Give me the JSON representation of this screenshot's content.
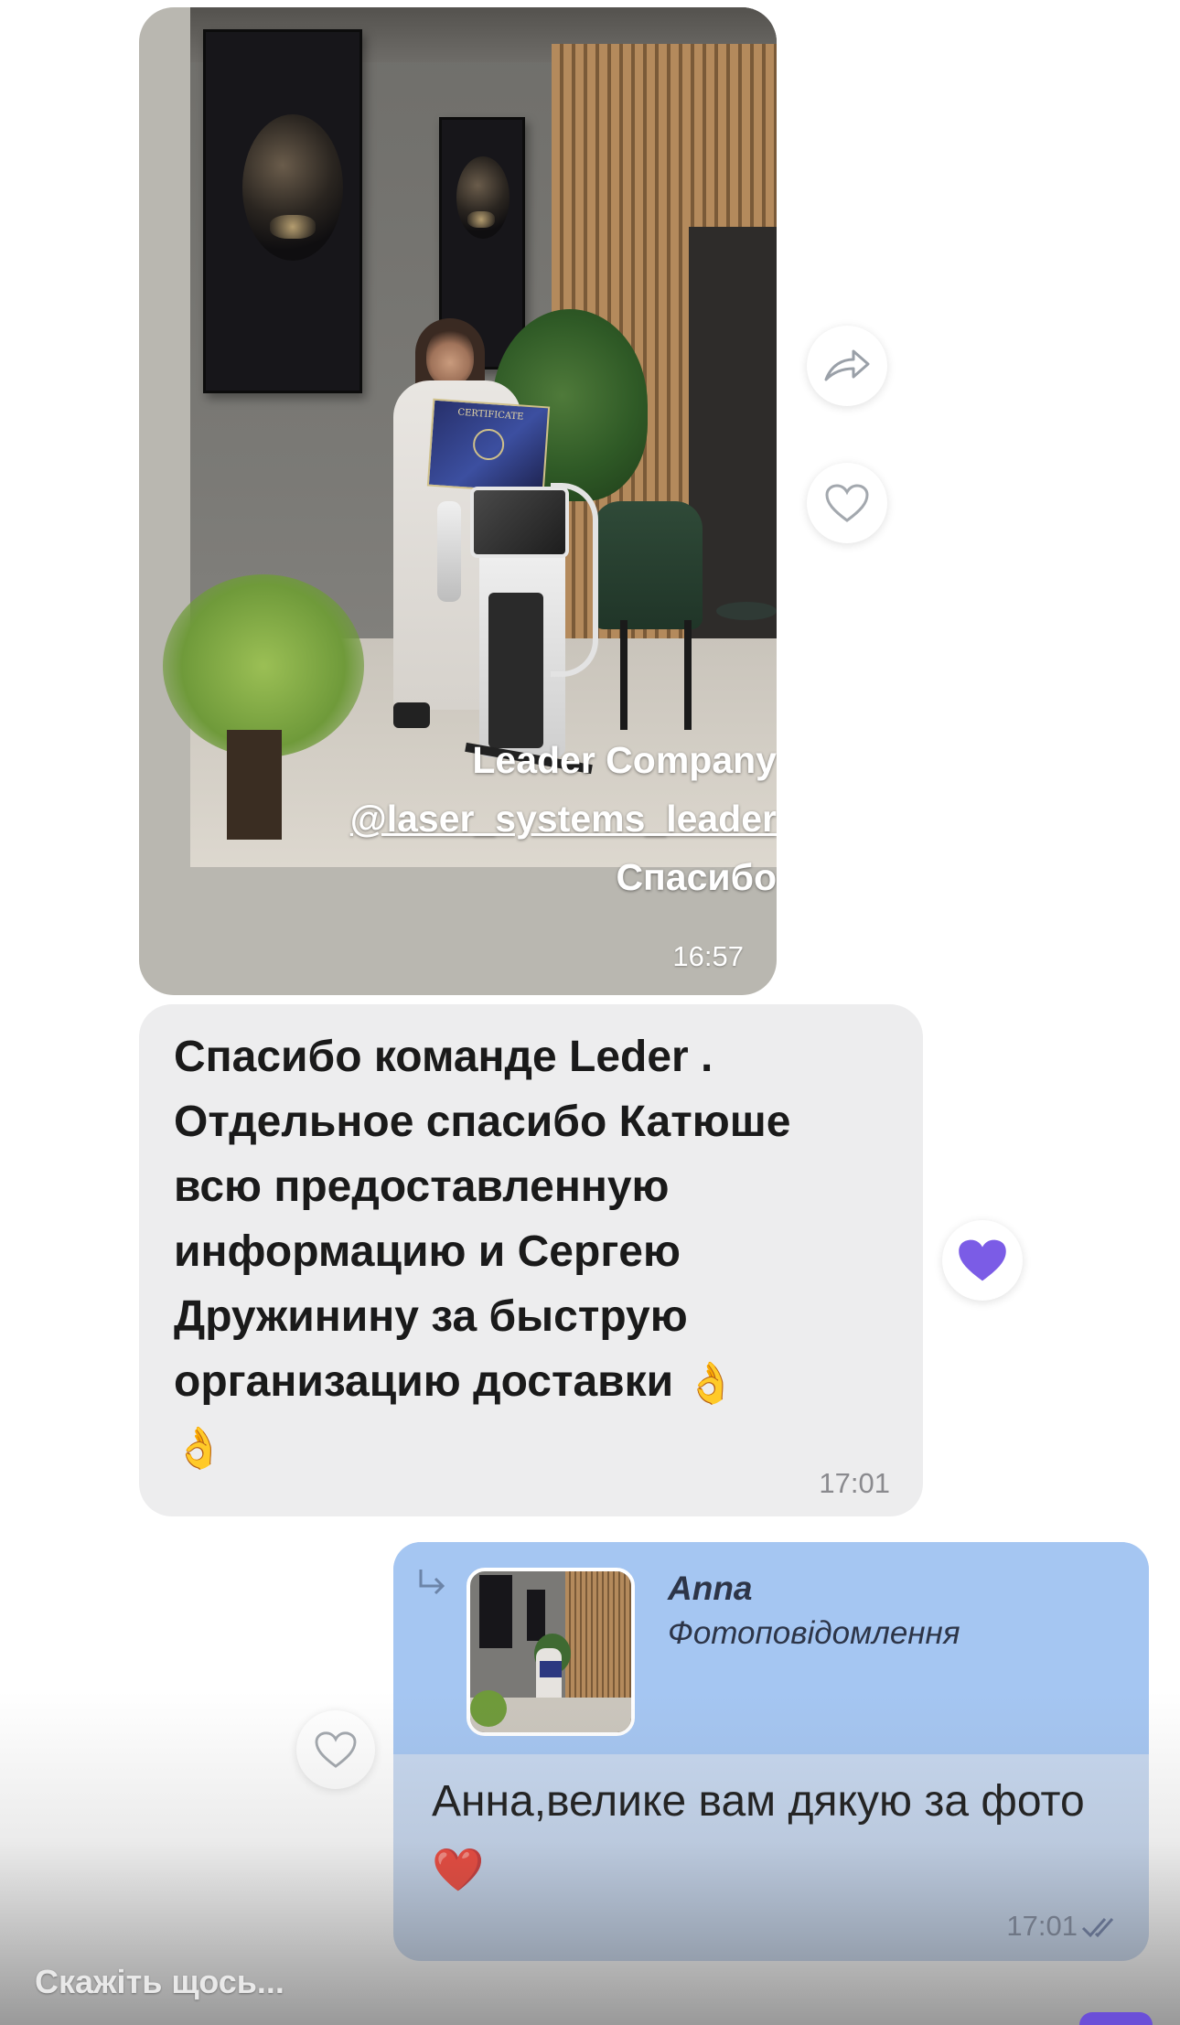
{
  "photo_message": {
    "overlay_line1": "Leader Company",
    "overlay_line2": "@laser_systems_leader",
    "overlay_line3": "Спасибо",
    "time": "16:57",
    "certificate_label": "CERTIFICATE"
  },
  "side_actions": {
    "share_icon": "share-arrow-icon",
    "like_icon": "heart-outline-icon",
    "reaction_icon": "purple-heart-icon",
    "reaction_color": "#7b5ce6"
  },
  "incoming_message": {
    "lines": [
      "Спасибо команде Leder .",
      "Отдельное спасибо Катюше",
      "всю предоставленную",
      "информацию и Сергею",
      "Дружинину за быструю",
      "организацию доставки"
    ],
    "emoji": "👌",
    "time": "17:01"
  },
  "outgoing_message": {
    "reply_to_name": "Anna",
    "reply_to_type": "Фотоповідомлення",
    "text": "Анна,велике вам дякую за фото",
    "emoji": "❤️",
    "time": "17:01",
    "status_icon": "double-check-icon"
  },
  "composer": {
    "placeholder": "Скажіть щось..."
  },
  "colors": {
    "incoming_bubble": "#ededee",
    "outgoing_bubble": "#c7d8f0",
    "quote_area": "#a5c6f2",
    "accent_purple": "#7b5ce6"
  }
}
